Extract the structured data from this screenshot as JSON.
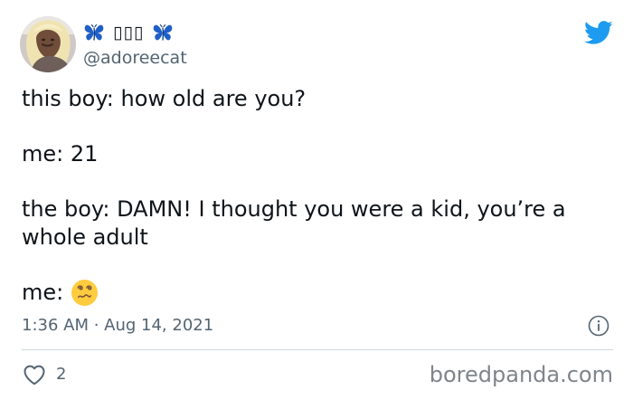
{
  "colors": {
    "text_primary": "#0f1419",
    "text_secondary": "#536471",
    "twitter_blue": "#1d9bf0",
    "butterfly_blue": "#1f5fc8",
    "divider": "#cfd9de",
    "emoji_yellow": "#ffcc3d",
    "watermark_gray": "#7f858a"
  },
  "icons": {
    "left_butterfly": "butterfly-icon",
    "right_butterfly": "butterfly-icon",
    "twitter_logo": "twitter-bird-icon",
    "reaction_emoji": "dizzy-face-icon",
    "info": "info-circle-icon",
    "like": "heart-outline-icon"
  },
  "tweet": {
    "author": {
      "display_name": "▯▯▯",
      "handle": "@adoreecat"
    },
    "lines": {
      "line1": "this boy: how old are you?",
      "line2": "me: 21",
      "line3": "the boy: DAMN! I thought you were a kid, you’re a whole adult",
      "line4_prefix": "me:"
    },
    "timestamp": "1:36 AM · Aug 14, 2021",
    "likes": "2"
  },
  "watermark": "boredpanda.com"
}
